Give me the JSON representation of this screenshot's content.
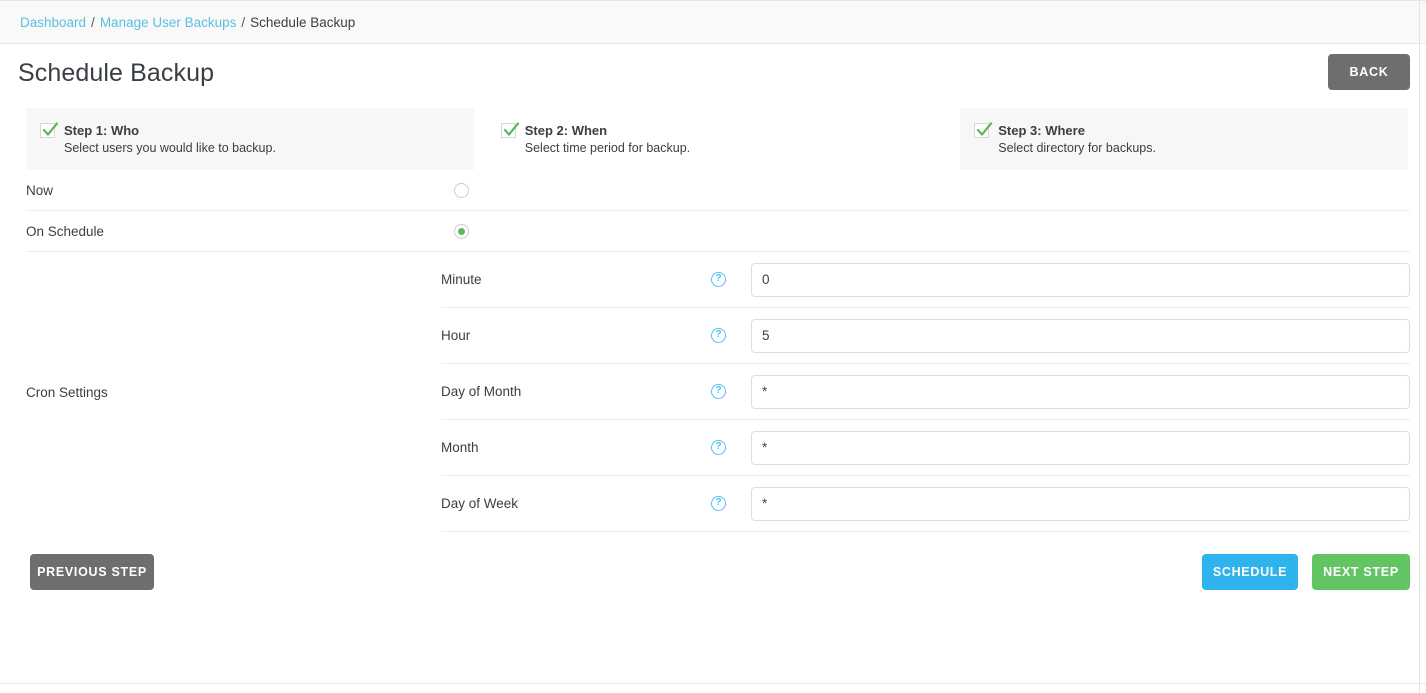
{
  "breadcrumb": {
    "items": [
      {
        "label": "Dashboard",
        "link": true
      },
      {
        "label": "Manage User Backups",
        "link": true
      },
      {
        "label": "Schedule Backup",
        "link": false
      }
    ],
    "separator": "/"
  },
  "header": {
    "title": "Schedule Backup",
    "back_label": "BACK"
  },
  "steps": [
    {
      "title": "Step 1: Who",
      "description": "Select users you would like to backup.",
      "state": "active",
      "icon": "check-icon"
    },
    {
      "title": "Step 2: When",
      "description": "Select time period for backup.",
      "state": "inactive",
      "icon": "check-icon"
    },
    {
      "title": "Step 3: Where",
      "description": "Select directory for backups.",
      "state": "active",
      "icon": "check-icon"
    }
  ],
  "schedule_options": [
    {
      "label": "Now",
      "selected": false
    },
    {
      "label": "On Schedule",
      "selected": true
    }
  ],
  "cron": {
    "section_label": "Cron Settings",
    "help_glyph": "?",
    "fields": [
      {
        "label": "Minute",
        "value": "0"
      },
      {
        "label": "Hour",
        "value": "5"
      },
      {
        "label": "Day of Month",
        "value": "*"
      },
      {
        "label": "Month",
        "value": "*"
      },
      {
        "label": "Day of Week",
        "value": "*"
      }
    ]
  },
  "footer": {
    "previous_label": "PREVIOUS STEP",
    "schedule_label": "SCHEDULE",
    "next_label": "NEXT STEP"
  },
  "colors": {
    "link": "#5bc0de",
    "check_green": "#5cb85c",
    "radio_green": "#5cb85c",
    "help_blue": "#4cc3ef",
    "btn_grey": "#6c6e70",
    "btn_blue": "#2fb3ec",
    "btn_green": "#62c462",
    "panel_grey": "#f7f7f7"
  }
}
